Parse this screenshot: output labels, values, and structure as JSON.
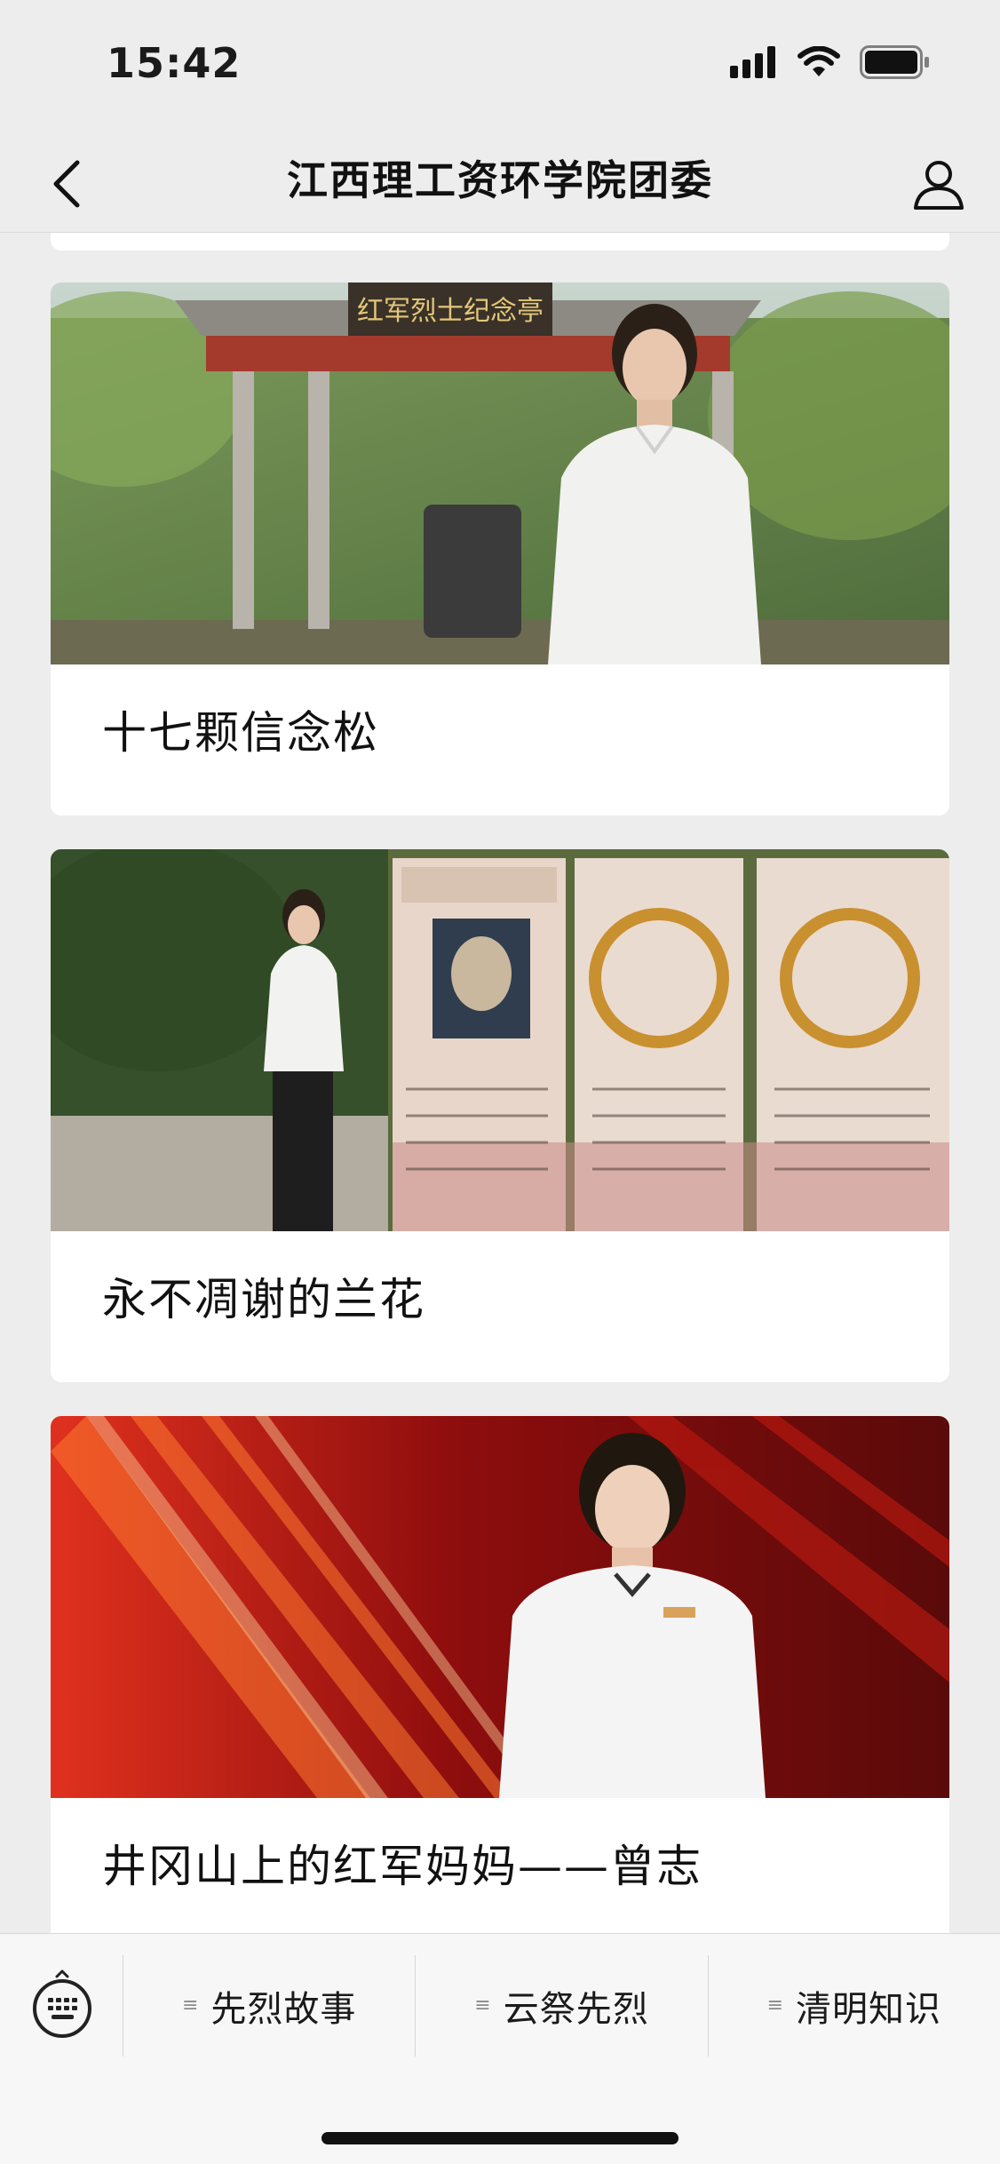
{
  "status_bar": {
    "time": "15:42"
  },
  "nav": {
    "title": "江西理工资环学院团委"
  },
  "articles": [
    {
      "title": "十七颗信念松",
      "image_label": "红军烈士纪念亭"
    },
    {
      "title": "永不凋谢的兰花"
    },
    {
      "title": "井冈山上的红军妈妈——曾志"
    }
  ],
  "bottom_menu": {
    "items": [
      {
        "label": "先烈故事"
      },
      {
        "label": "云祭先烈"
      },
      {
        "label": "清明知识"
      }
    ]
  },
  "colors": {
    "background": "#ededed",
    "card": "#ffffff",
    "text": "#111111",
    "banner_red": "#b31212"
  }
}
